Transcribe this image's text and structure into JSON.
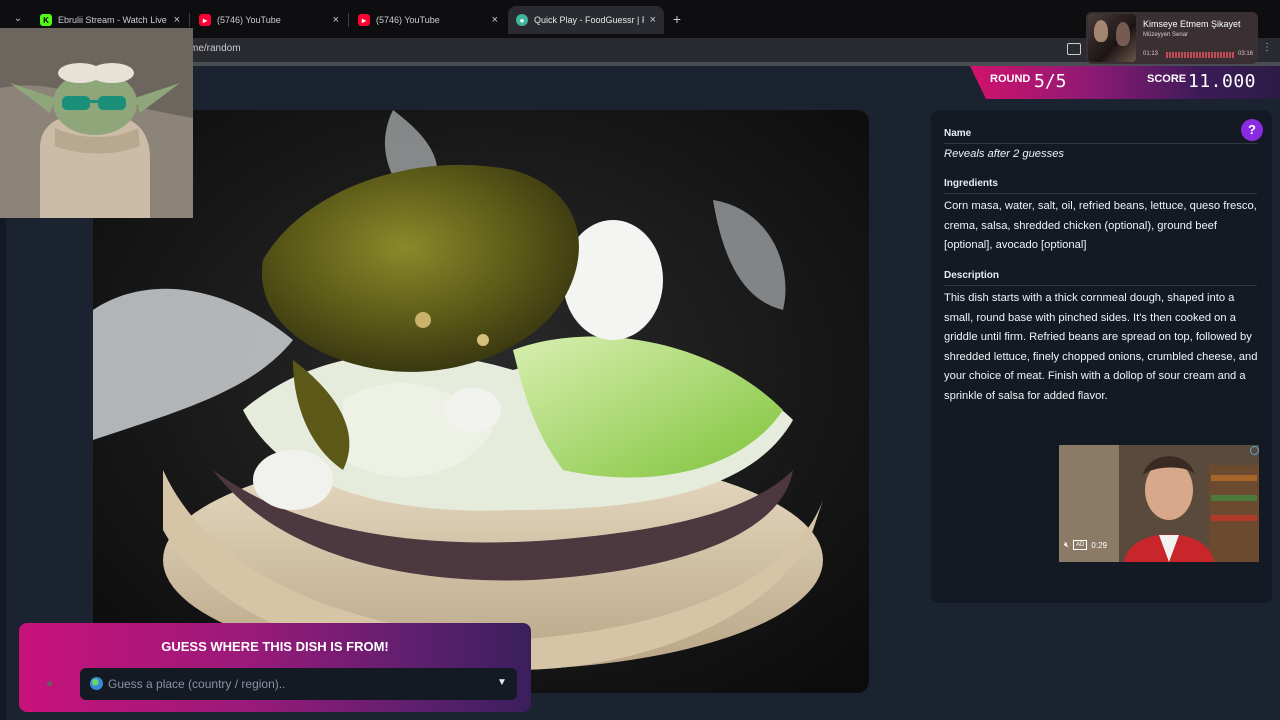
{
  "browser": {
    "tabs": [
      {
        "title": "Ebrulii Stream - Watch Live on K",
        "favicon": "kick-icon",
        "color": "#53fc18",
        "active": false
      },
      {
        "title": "(5746) YouTube",
        "favicon": "youtube-icon",
        "color": "#ff0033",
        "active": false
      },
      {
        "title": "(5746) YouTube",
        "favicon": "youtube-icon",
        "color": "#ff0033",
        "active": false
      },
      {
        "title": "Quick Play - FoodGuessr | Food",
        "favicon": "foodguessr-icon",
        "color": "#3fb5a0",
        "active": true
      }
    ],
    "address": "me/random"
  },
  "media_player": {
    "title": "Kimseye Etmem Şikayet",
    "artist": "Müzeyyen Senar",
    "time_elapsed": "01:13",
    "time_total": "03:16"
  },
  "hud": {
    "round_label": "ROUND",
    "round_value": "5/5",
    "score_label": "SCORE",
    "score_value": "11.000"
  },
  "panel": {
    "name_label": "Name",
    "name_value": "Reveals after 2 guesses",
    "ingredients_label": "Ingredients",
    "ingredients_value": "Corn masa, water, salt, oil, refried beans, lettuce, queso fresco, crema, salsa, shredded chicken (optional), ground beef [optional], avocado [optional]",
    "description_label": "Description",
    "description_value": "This dish starts with a thick cornmeal dough, shaped into a small, round base with pinched sides. It's then cooked on a griddle until firm. Refried beans are spread on top, followed by shredded lettuce, finely chopped onions, crumbled cheese, and your choice of meat. Finish with a dollop of sour cream and a sprinkle of salsa for added flavor."
  },
  "ad": {
    "badge": "AD",
    "time": "0:29"
  },
  "guess": {
    "title": "GUESS WHERE THIS DISH IS FROM!",
    "placeholder": "Guess a place (country / region).."
  }
}
